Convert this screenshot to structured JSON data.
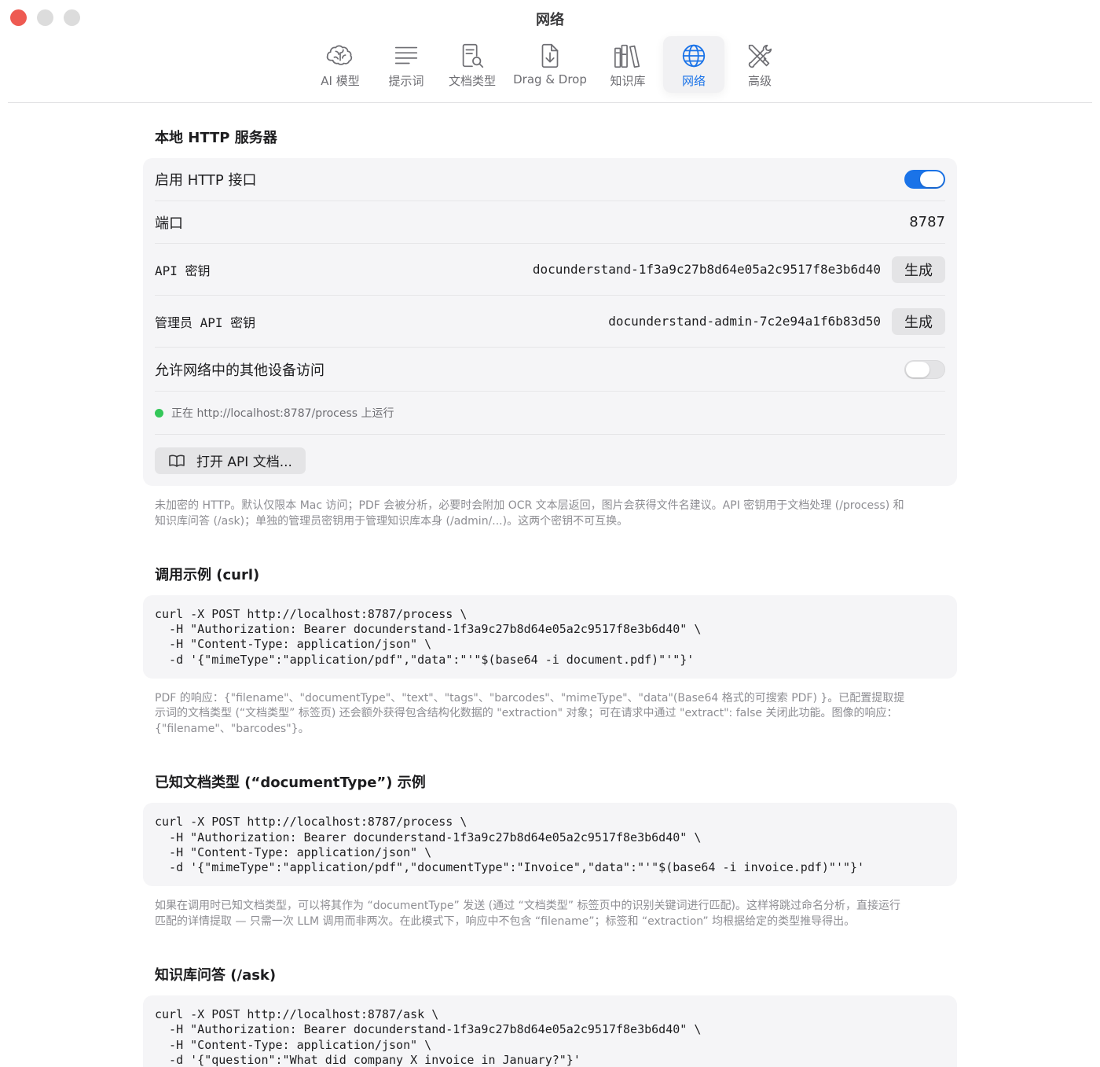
{
  "window": {
    "title": "网络"
  },
  "toolbar": {
    "items": [
      {
        "label": "AI 模型",
        "icon": "brain-icon"
      },
      {
        "label": "提示词",
        "icon": "text-lines-icon"
      },
      {
        "label": "文档类型",
        "icon": "doc-search-icon"
      },
      {
        "label": "Drag & Drop",
        "icon": "doc-download-icon"
      },
      {
        "label": "知识库",
        "icon": "books-icon"
      },
      {
        "label": "网络",
        "icon": "globe-icon"
      },
      {
        "label": "高级",
        "icon": "tools-icon"
      }
    ],
    "active": "网络"
  },
  "http": {
    "section_title": "本地 HTTP 服务器",
    "enable_label": "启用 HTTP 接口",
    "enable_on": true,
    "port_label": "端口",
    "port_value": "8787",
    "api_key_label": "API 密钥",
    "api_key_value": "docunderstand-1f3a9c27b8d64e05a2c9517f8e3b6d40",
    "admin_key_label": "管理员 API 密钥",
    "admin_key_value": "docunderstand-admin-7c2e94a1f6b83d50",
    "generate_label": "生成",
    "lan_label": "允许网络中的其他设备访问",
    "lan_on": false,
    "status_text": "正在 http://localhost:8787/process 上运行",
    "open_docs_label": "打开 API 文档...",
    "note_1": "未加密的 HTTP。默认仅限本 Mac 访问；PDF 会被分析，必要时会附加 OCR 文本层返回，图片会获得文件名建议。API 密钥用于文档处理 (/process) 和",
    "note_2": "知识库问答 (/ask)；单独的管理员密钥用于管理知识库本身 (/admin/...)。这两个密钥不可互换。"
  },
  "curl_example": {
    "title": "调用示例 (curl)",
    "lines": [
      "curl -X POST http://localhost:8787/process \\",
      "  -H \"Authorization: Bearer docunderstand-1f3a9c27b8d64e05a2c9517f8e3b6d40\" \\",
      "  -H \"Content-Type: application/json\" \\",
      "  -d '{\"mimeType\":\"application/pdf\",\"data\":\"'\"$(base64 -i document.pdf)\"'\"}'"
    ],
    "note_1": "PDF 的响应：{\"filename\"、\"documentType\"、\"text\"、\"tags\"、\"barcodes\"、\"mimeType\"、\"data\"(Base64 格式的可搜索 PDF) }。已配置提取提",
    "note_2": "示词的文档类型 (“文档类型” 标签页) 还会额外获得包含结构化数据的 \"extraction\" 对象；可在请求中通过 \"extract\": false 关闭此功能。图像的响应：",
    "note_3": "{\"filename\"、\"barcodes\"}。"
  },
  "doctype_example": {
    "title": "已知文档类型 (“documentType”) 示例",
    "lines": [
      "curl -X POST http://localhost:8787/process \\",
      "  -H \"Authorization: Bearer docunderstand-1f3a9c27b8d64e05a2c9517f8e3b6d40\" \\",
      "  -H \"Content-Type: application/json\" \\",
      "  -d '{\"mimeType\":\"application/pdf\",\"documentType\":\"Invoice\",\"data\":\"'\"$(base64 -i invoice.pdf)\"'\"}'"
    ],
    "note_1": "如果在调用时已知文档类型，可以将其作为 “documentType” 发送 (通过 “文档类型” 标签页中的识别关键词进行匹配)。这样将跳过命名分析，直接运行",
    "note_2": "匹配的详情提取 — 只需一次 LLM 调用而非两次。在此模式下，响应中不包含 “filename”；标签和 “extraction” 均根据给定的类型推导得出。"
  },
  "ask_example": {
    "title": "知识库问答 (/ask)",
    "lines": [
      "curl -X POST http://localhost:8787/ask \\",
      "  -H \"Authorization: Bearer docunderstand-1f3a9c27b8d64e05a2c9517f8e3b6d40\" \\",
      "  -H \"Content-Type: application/json\" \\",
      "  -d '{\"question\":\"What did company X invoice in January?\"}'"
    ]
  },
  "colors": {
    "accent": "#1a73e8",
    "status_green": "#34c759",
    "close_red": "#ee5a52"
  }
}
